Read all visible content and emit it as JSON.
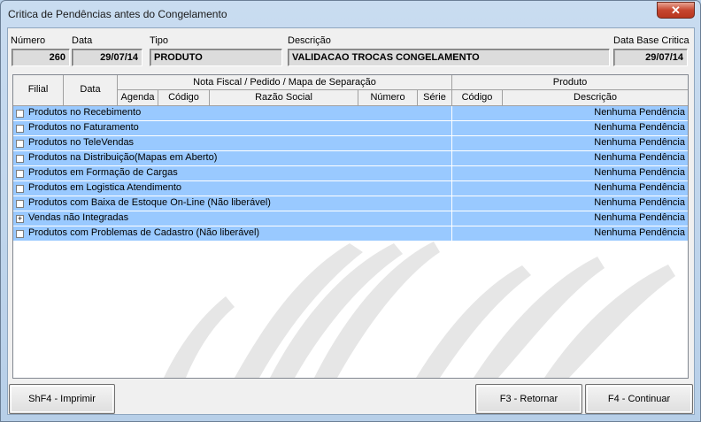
{
  "window": {
    "title": "Critica de Pendências antes do Congelamento",
    "close_glyph": "✕"
  },
  "header": {
    "numero": {
      "label": "Número",
      "value": "260"
    },
    "data": {
      "label": "Data",
      "value": "29/07/14"
    },
    "tipo": {
      "label": "Tipo",
      "value": "PRODUTO"
    },
    "descricao": {
      "label": "Descrição",
      "value": "VALIDACAO TROCAS CONGELAMENTO"
    },
    "data_base": {
      "label": "Data Base Critica",
      "value": "29/07/14"
    }
  },
  "grid": {
    "columns": {
      "filial": "Filial",
      "data": "Data",
      "group_nf": "Nota Fiscal / Pedido / Mapa de Separação",
      "agenda": "Agenda",
      "codigo": "Código",
      "razao_social": "Razão Social",
      "numero": "Número",
      "serie": "Série",
      "group_produto": "Produto",
      "produto_codigo": "Código",
      "produto_descricao": "Descrição"
    },
    "rows": [
      {
        "label": "Produtos no Recebimento",
        "status": "Nenhuma Pendência",
        "toggle": "checkbox"
      },
      {
        "label": "Produtos no Faturamento",
        "status": "Nenhuma Pendência",
        "toggle": "checkbox"
      },
      {
        "label": "Produtos no TeleVendas",
        "status": "Nenhuma Pendência",
        "toggle": "checkbox"
      },
      {
        "label": "Produtos na Distribuição(Mapas em Aberto)",
        "status": "Nenhuma Pendência",
        "toggle": "checkbox"
      },
      {
        "label": "Produtos em Formação de Cargas",
        "status": "Nenhuma Pendência",
        "toggle": "checkbox"
      },
      {
        "label": "Produtos em Logistica Atendimento",
        "status": "Nenhuma Pendência",
        "toggle": "checkbox"
      },
      {
        "label": "Produtos com Baixa de Estoque On-Line (Não liberável)",
        "status": "Nenhuma Pendência",
        "toggle": "checkbox"
      },
      {
        "label": "Vendas não Integradas",
        "status": "Nenhuma Pendência",
        "toggle": "expand",
        "expand_glyph": "+"
      },
      {
        "label": "Produtos com Problemas de Cadastro (Não liberável)",
        "status": "Nenhuma Pendência",
        "toggle": "checkbox"
      }
    ]
  },
  "buttons": {
    "imprimir": "ShF4 - Imprimir",
    "retornar": "F3 - Retornar",
    "continuar": "F4 - Continuar"
  },
  "colors": {
    "row_highlight": "#99c9ff",
    "panel": "#f0f0f0",
    "frame": "#b9d1ea"
  }
}
